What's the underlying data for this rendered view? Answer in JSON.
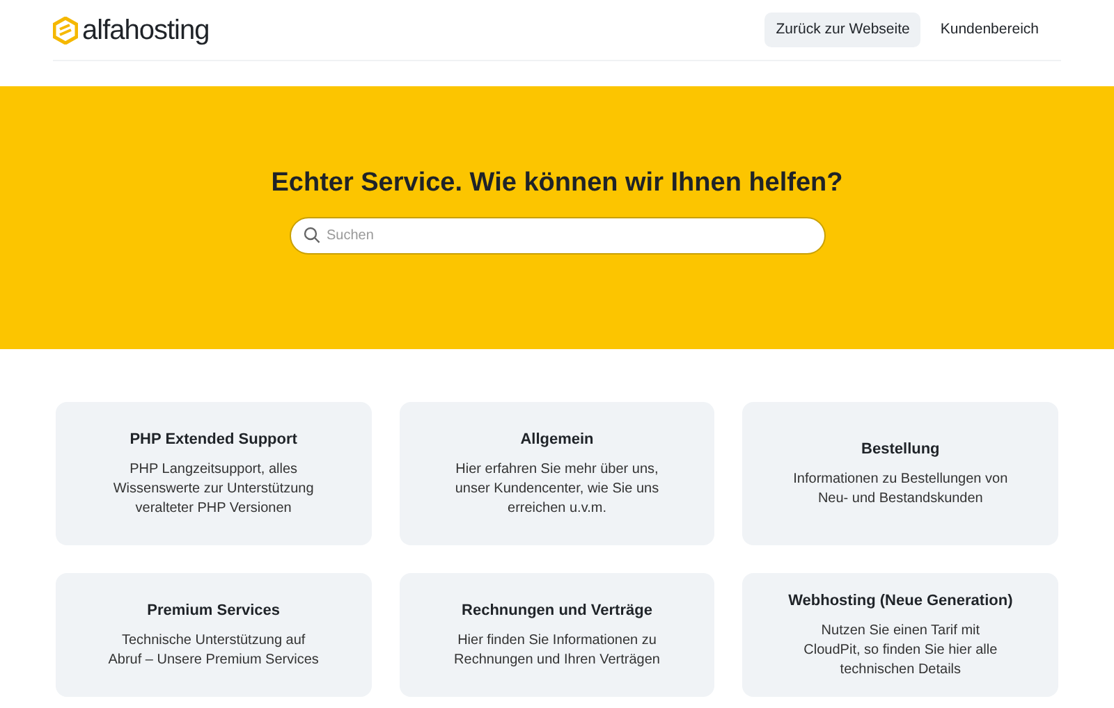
{
  "header": {
    "logo": "alfahosting",
    "nav": [
      {
        "label": "Zurück zur Webseite",
        "selected": true
      },
      {
        "label": "Kundenbereich",
        "selected": false
      }
    ]
  },
  "hero": {
    "title": "Echter Service. Wie können wir Ihnen helfen?",
    "search": {
      "placeholder": "Suchen"
    }
  },
  "categories": [
    {
      "title": "PHP Extended Support",
      "description": "PHP Langzeitsupport, alles Wissenswerte zur Unterstützung veralteter PHP Versionen"
    },
    {
      "title": "Allgemein",
      "description": "Hier erfahren Sie mehr über uns, unser Kundencenter, wie Sie uns erreichen u.v.m."
    },
    {
      "title": "Bestellung",
      "description": "Informationen zu Bestellungen von Neu- und Bestandskunden"
    },
    {
      "title": "Premium Services",
      "description": "Technische Unterstützung auf Abruf – Unsere Premium Services"
    },
    {
      "title": "Rechnungen und Verträge",
      "description": "Hier finden Sie Informationen zu Rechnungen und Ihren Verträgen"
    },
    {
      "title": "Webhosting (Neue Generation)",
      "description": "Nutzen Sie einen Tarif mit CloudPit, so finden Sie hier alle technischen Details"
    }
  ]
}
